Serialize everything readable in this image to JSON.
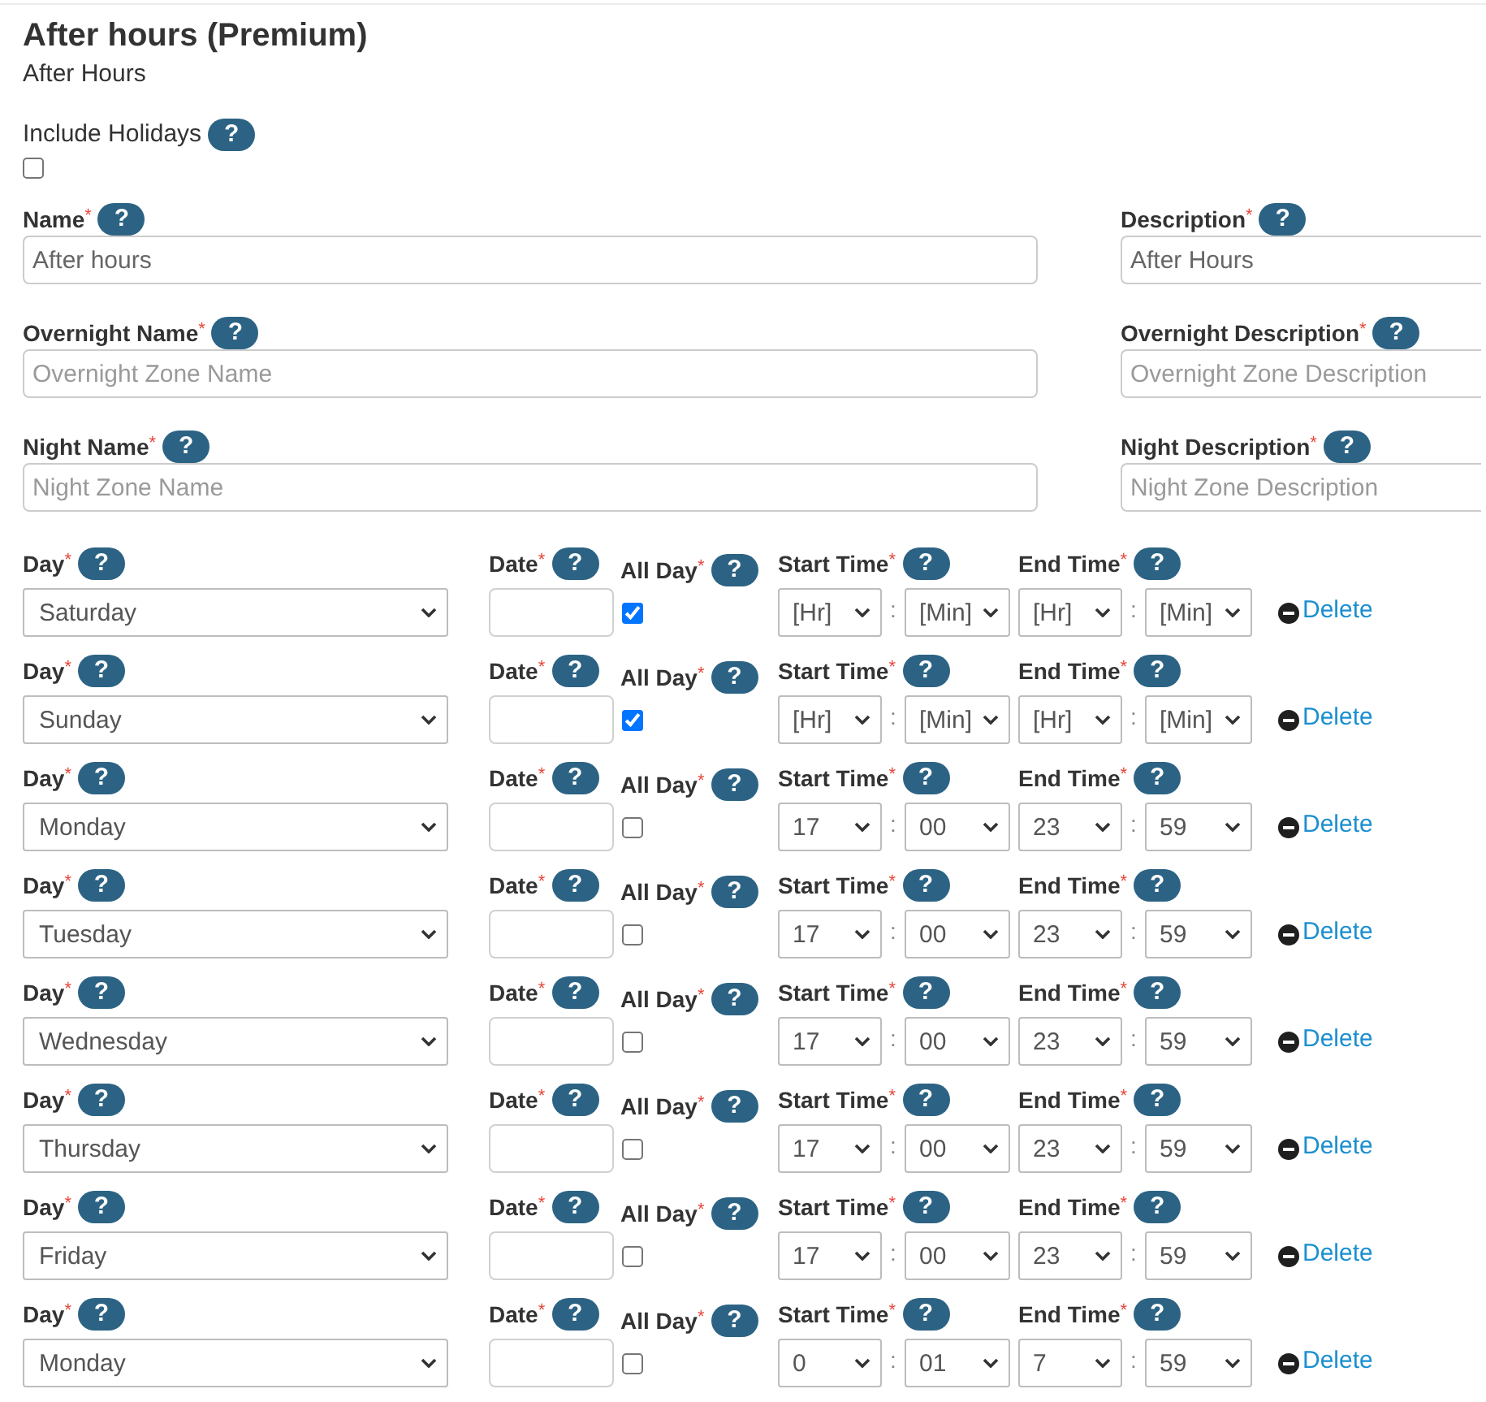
{
  "header": {
    "title": "After hours (Premium)",
    "subtitle": "After Hours"
  },
  "include_holidays": {
    "label": "Include Holidays",
    "help": "?",
    "checked": false
  },
  "fields": [
    {
      "label": "Name$^{*}$",
      "help": "?",
      "value": "After hours"
    },
    {
      "label": "Description$^{*}$",
      "help": "?",
      "value": "After Hours"
    },
    {
      "label": "Overnight Name$^{*}$",
      "help": "?",
      "placeholder": "Overnight Zone Name"
    },
    {
      "label": "Overnight Description$^{*}$",
      "help": "?",
      "placeholder": "Overnight Zone Description"
    },
    {
      "label": "Night Name$^{*}$",
      "help": "?",
      "placeholder": "Night Zone Name"
    },
    {
      "label": "Night Description$^{*}$",
      "help": "?",
      "placeholder": "Night Zone Description"
    }
  ],
  "schedule": [
    {
      "day_label": "Day$^{*}$",
      "day_help": "?",
      "day": "Saturday",
      "date_label": "Date$^{*}$",
      "date_help": "?",
      "all_day_label": "All Day$^{*}$",
      "all_day_help": "?",
      "all_day": true,
      "start_label": "Start Time$^{*}$",
      "start_help": "?",
      "start_hour": "[Hr]",
      "start_separator": ":",
      "start_minute": "[Min]",
      "end_label": "End Time$^{*}$",
      "end_help": "?",
      "end_hour": "[Hr]",
      "end_separator": ":",
      "end_minute": "[Min]",
      "delete": "Delete"
    },
    {
      "day_label": "Day$^{*}$",
      "day_help": "?",
      "day": "Sunday",
      "date_label": "Date$^{*}$",
      "date_help": "?",
      "all_day_label": "All Day$^{*}$",
      "all_day_help": "?",
      "all_day": true,
      "start_label": "Start Time$^{*}$",
      "start_help": "?",
      "start_hour": "[Hr]",
      "start_separator": ":",
      "start_minute": "[Min]",
      "end_label": "End Time$^{*}$",
      "end_help": "?",
      "end_hour": "[Hr]",
      "end_separator": ":",
      "end_minute": "[Min]",
      "delete": "Delete"
    },
    {
      "day_label": "Day$^{*}$",
      "day_help": "?",
      "day": "Monday",
      "date_label": "Date$^{*}$",
      "date_help": "?",
      "all_day_label": "All Day$^{*}$",
      "all_day_help": "?",
      "all_day": false,
      "start_label": "Start Time$^{*}$",
      "start_help": "?",
      "start_hour": "17",
      "start_separator": ":",
      "start_minute": "00",
      "end_label": "End Time$^{*}$",
      "end_help": "?",
      "end_hour": "23",
      "end_separator": ":",
      "end_minute": "59",
      "delete": "Delete"
    },
    {
      "day_label": "Day$^{*}$",
      "day_help": "?",
      "day": "Tuesday",
      "date_label": "Date$^{*}$",
      "date_help": "?",
      "all_day_label": "All Day$^{*}$",
      "all_day_help": "?",
      "all_day": false,
      "start_label": "Start Time$^{*}$",
      "start_help": "?",
      "start_hour": "17",
      "start_separator": ":",
      "start_minute": "00",
      "end_label": "End Time$^{*}$",
      "end_help": "?",
      "end_hour": "23",
      "end_separator": ":",
      "end_minute": "59",
      "delete": "Delete"
    },
    {
      "day_label": "Day$^{*}$",
      "day_help": "?",
      "day": "Wednesday",
      "date_label": "Date$^{*}$",
      "date_help": "?",
      "all_day_label": "All Day$^{*}$",
      "all_day_help": "?",
      "all_day": false,
      "start_label": "Start Time$^{*}$",
      "start_help": "?",
      "start_hour": "17",
      "start_separator": ":",
      "start_minute": "00",
      "end_label": "End Time$^{*}$",
      "end_help": "?",
      "end_hour": "23",
      "end_separator": ":",
      "end_minute": "59",
      "delete": "Delete"
    },
    {
      "day_label": "Day$^{*}$",
      "day_help": "?",
      "day": "Thursday",
      "date_label": "Date$^{*}$",
      "date_help": "?",
      "all_day_label": "All Day$^{*}$",
      "all_day_help": "?",
      "all_day": false,
      "start_label": "Start Time$^{*}$",
      "start_help": "?",
      "start_hour": "17",
      "start_separator": ":",
      "start_minute": "00",
      "end_label": "End Time$^{*}$",
      "end_help": "?",
      "end_hour": "23",
      "end_separator": ":",
      "end_minute": "59",
      "delete": "Delete"
    },
    {
      "day_label": "Day$^{*}$",
      "day_help": "?",
      "day": "Friday",
      "date_label": "Date$^{*}$",
      "date_help": "?",
      "all_day_label": "All Day$^{*}$",
      "all_day_help": "?",
      "all_day": false,
      "start_label": "Start Time$^{*}$",
      "start_help": "?",
      "start_hour": "17",
      "start_separator": ":",
      "start_minute": "00",
      "end_label": "End Time$^{*}$",
      "end_help": "?",
      "end_hour": "23",
      "end_separator": ":",
      "end_minute": "59",
      "delete": "Delete"
    },
    {
      "day_label": "Day$^{*}$",
      "day_help": "?",
      "day": "Monday",
      "date_label": "Date$^{*}$",
      "date_help": "?",
      "all_day_label": "All Day$^{*}$",
      "all_day_help": "?",
      "all_day": false,
      "start_label": "Start Time$^{*}$",
      "start_help": "?",
      "start_hour": "0",
      "start_separator": ":",
      "start_minute": "01",
      "end_label": "End Time$^{*}$",
      "end_help": "?",
      "end_hour": "7",
      "end_separator": ":",
      "end_minute": "59",
      "delete": "Delete"
    }
  ]
}
